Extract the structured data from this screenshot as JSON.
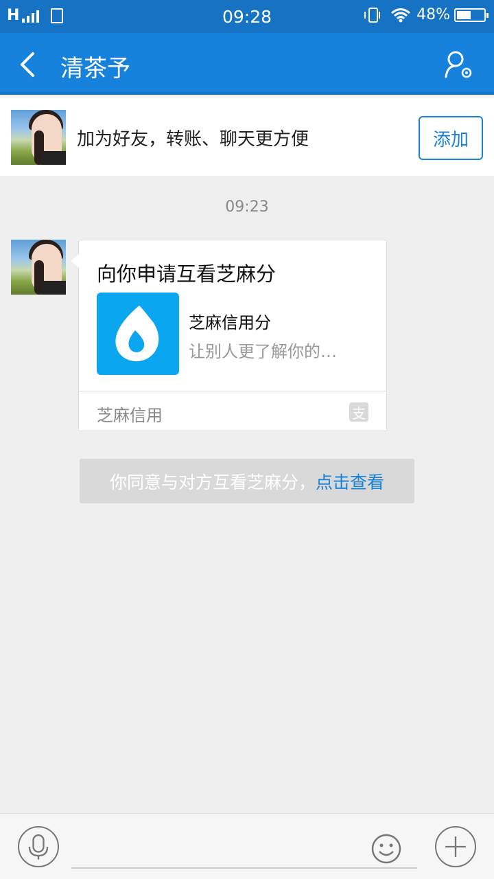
{
  "status_bar": {
    "network": "H",
    "time": "09:28",
    "battery_percent": "48%"
  },
  "nav": {
    "title": "清茶予",
    "back_icon": "chevron-left-icon",
    "profile_icon": "user-settings-icon"
  },
  "friend_banner": {
    "text": "加为好友，转账、聊天更方便",
    "add_button": "添加"
  },
  "chat": {
    "timestamp": "09:23",
    "card": {
      "title": "向你申请互看芝麻分",
      "app_name": "芝麻信用分",
      "app_desc": "让别人更了解你的…",
      "source": "芝麻信用",
      "source_icon": "alipay-icon",
      "icon_color": "#0aa6ef"
    },
    "notice": {
      "text": "你同意与对方互看芝麻分，",
      "link": "点击查看"
    }
  },
  "input_bar": {
    "voice_icon": "microphone-icon",
    "emoji_icon": "smiley-icon",
    "plus_icon": "plus-icon",
    "placeholder": ""
  },
  "colors": {
    "accent": "#1782dc",
    "status_bar": "#1673c4",
    "background": "#efefef"
  }
}
